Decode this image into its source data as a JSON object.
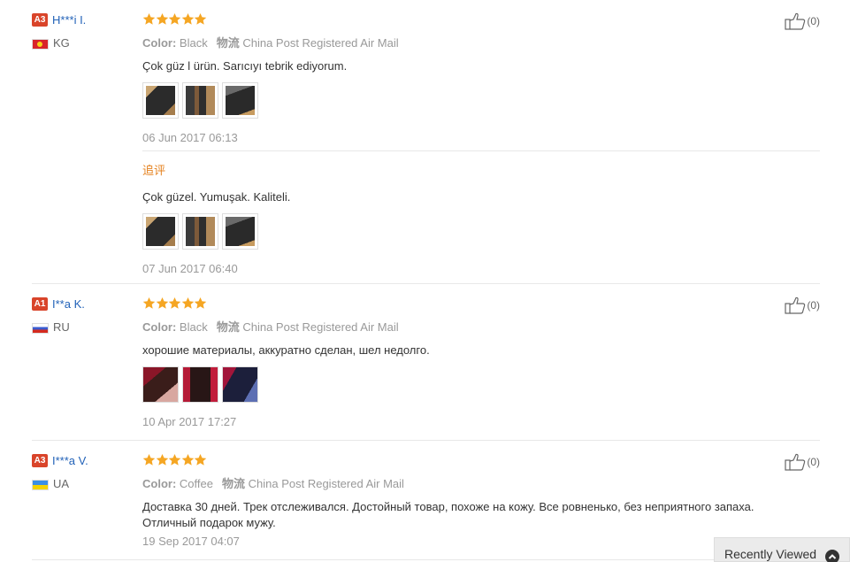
{
  "reviews": [
    {
      "level": "A3",
      "name": "H***i I.",
      "country": "KG",
      "flag": "kg",
      "color_label": "Color:",
      "color_value": "Black",
      "shipping_label": "物流",
      "shipping_value": "China Post Registered Air Mail",
      "text": "Çok güz l ürün. Sarıcıyı tebrik ediyorum.",
      "date": "06 Jun 2017 06:13",
      "likes": "(0)",
      "followup": {
        "label": "追评",
        "text": "Çok güzel. Yumuşak. Kaliteli.",
        "date": "07 Jun 2017 06:40"
      }
    },
    {
      "level": "A1",
      "name": "I**a K.",
      "country": "RU",
      "flag": "ru",
      "color_label": "Color:",
      "color_value": "Black",
      "shipping_label": "物流",
      "shipping_value": "China Post Registered Air Mail",
      "text": "хорошие материалы, аккуратно сделан, шел недолго.",
      "date": "10 Apr 2017 17:27",
      "likes": "(0)"
    },
    {
      "level": "A3",
      "name": "I***a V.",
      "country": "UA",
      "flag": "ua",
      "color_label": "Color:",
      "color_value": "Coffee",
      "shipping_label": "物流",
      "shipping_value": "China Post Registered Air Mail",
      "text": "Доставка 30 дней. Трек отслеживался. Достойный товар, похоже на кожу. Все ровненько, без неприятного запаха. Отличный подарок мужу.",
      "date": "19 Sep 2017 04:07",
      "likes": "(0)"
    }
  ],
  "recently_viewed": "Recently Viewed",
  "colors": {
    "star": "#f5a623",
    "name_link": "#2262b8",
    "level_badge": "#d9442a",
    "followup": "#e5821f"
  }
}
